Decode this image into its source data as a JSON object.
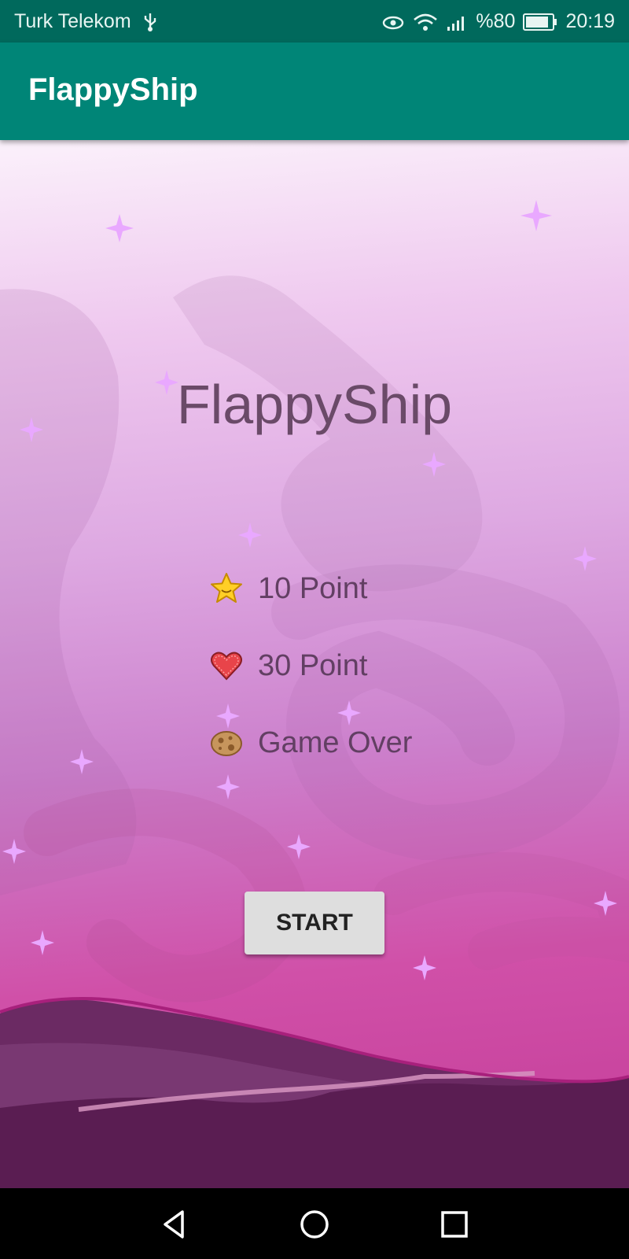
{
  "status_bar": {
    "carrier": "Turk Telekom",
    "battery": "%80",
    "time": "20:19",
    "icons": [
      "usb-icon",
      "eye-icon",
      "wifi-icon",
      "signal-icon",
      "battery-icon"
    ]
  },
  "app_bar": {
    "title": "FlappyShip"
  },
  "game": {
    "title": "FlappyShip",
    "legend": [
      {
        "icon": "star-icon",
        "label": "10 Point"
      },
      {
        "icon": "heart-icon",
        "label": "30 Point"
      },
      {
        "icon": "asteroid-icon",
        "label": "Game Over"
      }
    ],
    "start_label": "START"
  },
  "nav_bar": {
    "icons": [
      "back-icon",
      "home-icon",
      "recents-icon"
    ]
  },
  "colors": {
    "app_bar": "#008577",
    "status_bar": "#00695c",
    "title_text": "#6a4a68"
  }
}
